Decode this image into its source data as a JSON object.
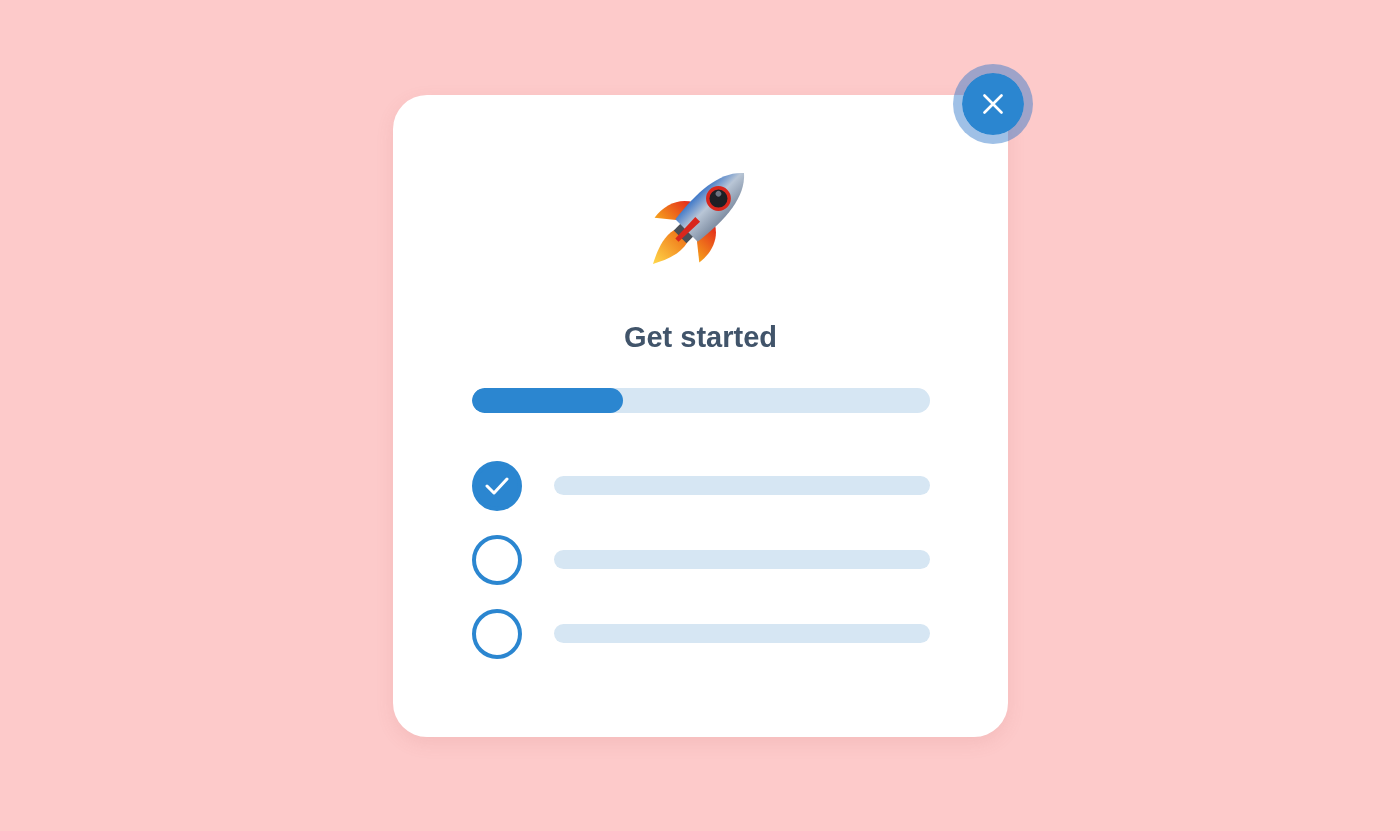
{
  "dialog": {
    "title": "Get started",
    "progress": {
      "level": 0.33
    },
    "checklist": [
      {
        "checked": true
      },
      {
        "checked": false
      },
      {
        "checked": false
      }
    ]
  }
}
